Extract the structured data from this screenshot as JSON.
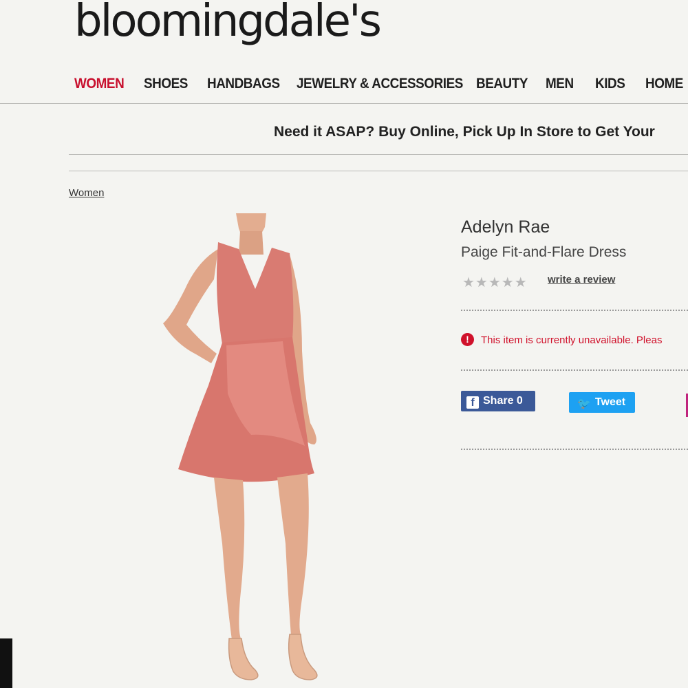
{
  "header": {
    "logo_text": "bloomingdale's"
  },
  "nav": {
    "items": [
      {
        "label": "WOMEN",
        "active": true
      },
      {
        "label": "SHOES"
      },
      {
        "label": "HANDBAGS"
      },
      {
        "label": "JEWELRY & ACCESSORIES"
      },
      {
        "label": "BEAUTY"
      },
      {
        "label": "MEN"
      },
      {
        "label": "KIDS"
      },
      {
        "label": "HOME"
      }
    ]
  },
  "promo": {
    "text": "Need it ASAP? Buy Online, Pick Up In Store to Get Your"
  },
  "breadcrumb": {
    "label": "Women"
  },
  "product": {
    "brand": "Adelyn Rae",
    "name": "Paige Fit-and-Flare Dress",
    "rating_stars": 0,
    "review_link": "write a review",
    "availability": "This item is currently unavailable. Pleas"
  },
  "social": {
    "share_label": "Share 0",
    "tweet_label": "Tweet"
  },
  "colors": {
    "accent": "#c8102e",
    "facebook": "#3b5998",
    "twitter": "#1da1f2",
    "dress": "#d97b72"
  }
}
